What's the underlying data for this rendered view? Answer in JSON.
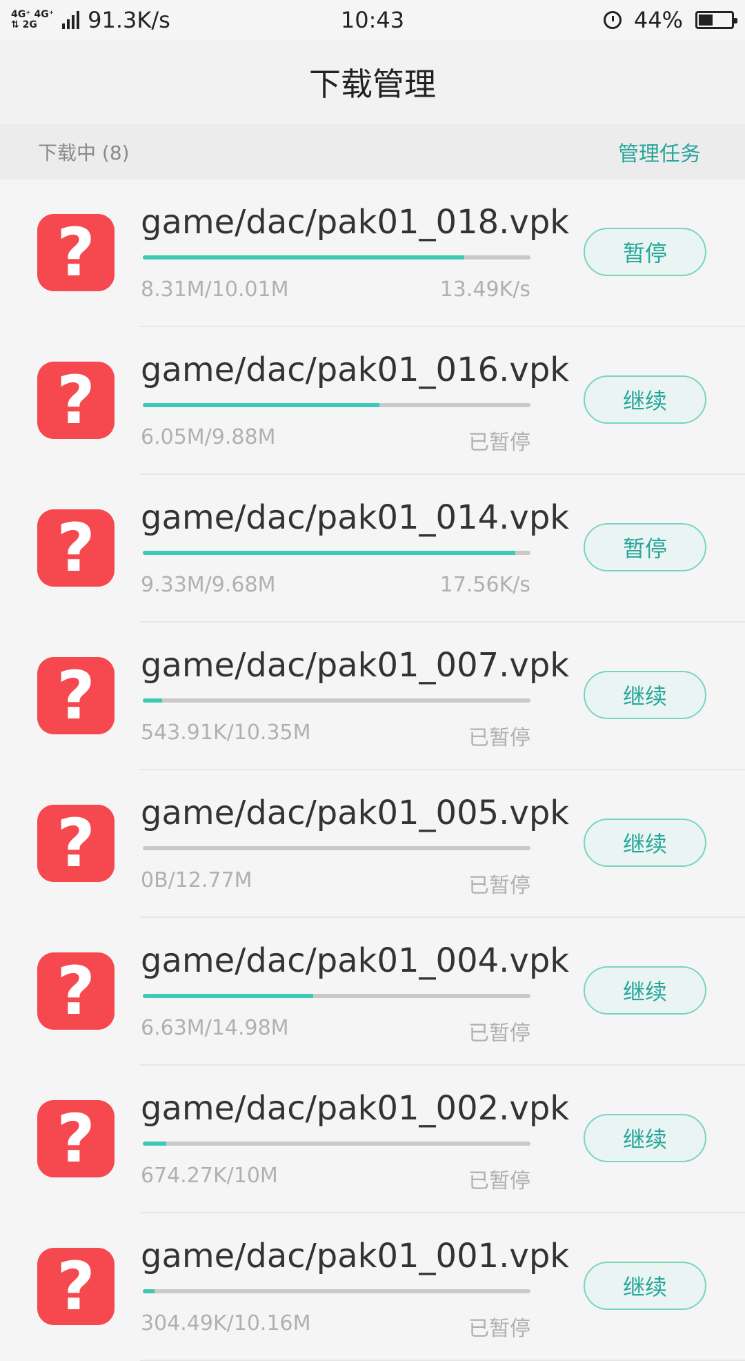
{
  "status_bar": {
    "net_top": "4G⁺ 4G⁺",
    "net_bottom": "⇅ 2G",
    "speed": "91.3K/s",
    "time": "10:43",
    "battery": "44%",
    "battery_level": 0.44,
    "alarm_icon": "alarm-icon",
    "battery_icon": "battery-icon"
  },
  "header": {
    "title": "下载管理"
  },
  "section": {
    "title": "下载中 (8)",
    "manage_label": "管理任务"
  },
  "colors": {
    "accent": "#26a69a",
    "progress": "#3ec9b6",
    "icon_bg": "#f5484f"
  },
  "downloads": [
    {
      "name": "game/dac/pak01_018.vpk",
      "size": "8.31M/10.01M",
      "state": "13.49K/s",
      "progress": 0.83,
      "action": "暂停"
    },
    {
      "name": "game/dac/pak01_016.vpk",
      "size": "6.05M/9.88M",
      "state": "已暂停",
      "progress": 0.61,
      "action": "继续"
    },
    {
      "name": "game/dac/pak01_014.vpk",
      "size": "9.33M/9.68M",
      "state": "17.56K/s",
      "progress": 0.96,
      "action": "暂停"
    },
    {
      "name": "game/dac/pak01_007.vpk",
      "size": "543.91K/10.35M",
      "state": "已暂停",
      "progress": 0.05,
      "action": "继续"
    },
    {
      "name": "game/dac/pak01_005.vpk",
      "size": "0B/12.77M",
      "state": "已暂停",
      "progress": 0.0,
      "action": "继续"
    },
    {
      "name": "game/dac/pak01_004.vpk",
      "size": "6.63M/14.98M",
      "state": "已暂停",
      "progress": 0.44,
      "action": "继续"
    },
    {
      "name": "game/dac/pak01_002.vpk",
      "size": "674.27K/10M",
      "state": "已暂停",
      "progress": 0.06,
      "action": "继续"
    },
    {
      "name": "game/dac/pak01_001.vpk",
      "size": "304.49K/10.16M",
      "state": "已暂停",
      "progress": 0.03,
      "action": "继续"
    }
  ]
}
